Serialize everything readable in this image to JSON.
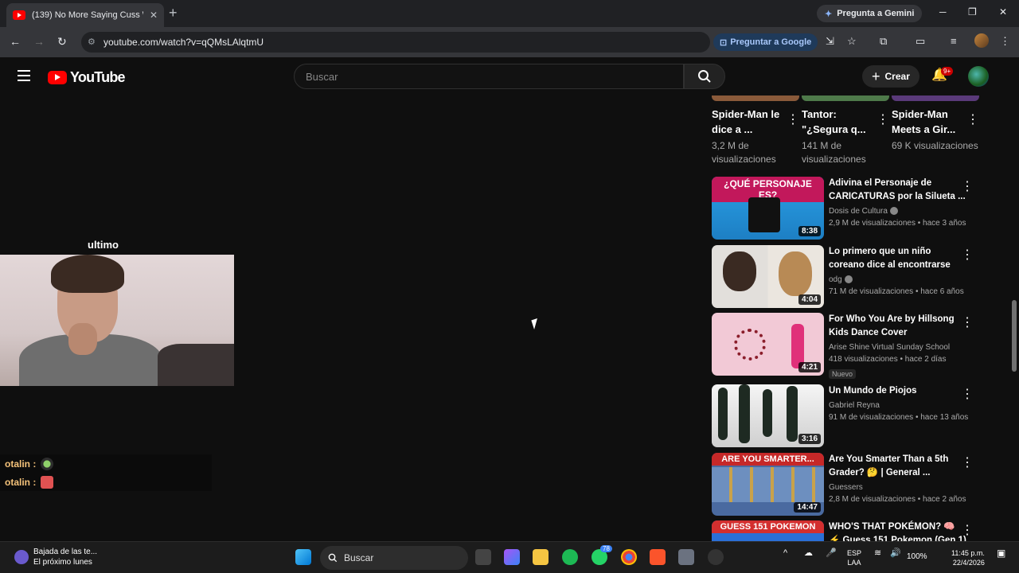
{
  "browser": {
    "tab_title": "(139) No More Saying Cuss Wo",
    "gemini_label": "Pregunta a Gemini",
    "url": "youtube.com/watch?v=qQMsLAlqtmU",
    "ask_google": "Preguntar a Google"
  },
  "youtube": {
    "logo_text": "YouTube",
    "search_placeholder": "Buscar",
    "create_label": "Crear",
    "notif_badge": "9+"
  },
  "overlay": {
    "label": "ultimo",
    "chat": [
      {
        "user": "otalin :",
        "emote": "green-face-emote"
      },
      {
        "user": "otalin :",
        "emote": "red-face-emote"
      }
    ]
  },
  "shorts": [
    {
      "title": "Spider-Man le dice a ...",
      "views": "3,2 M de visualizaciones",
      "thumb_color": "#8a5a3a"
    },
    {
      "title": "Tantor: \"¿Segura q...",
      "views": "141 M de visualizaciones",
      "thumb_color": "#4e7a4a"
    },
    {
      "title": "Spider-Man Meets a Gir...",
      "views": "69 K visualizaciones",
      "thumb_color": "#5a3a7a"
    }
  ],
  "videos": [
    {
      "title": "Adivina el Personaje de CARICATURAS por la Silueta ...",
      "channel": "Dosis de Cultura",
      "verified": true,
      "meta": "2,9 M de visualizaciones • hace 3 años",
      "duration": "8:38",
      "thumb_text": "¿QUÉ PERSONAJE ES?",
      "thumb_color": "#2aa0e6"
    },
    {
      "title": "Lo primero que un niño coreano dice al encontrarse con una ...",
      "channel": "odg",
      "verified": true,
      "meta": "71 M de visualizaciones • hace 6 años",
      "duration": "4:04",
      "thumb_text": "",
      "thumb_color": "#e8e4e0"
    },
    {
      "title": "For Who You Are by Hillsong Kids Dance Cover",
      "channel": "Arise Shine Virtual Sunday School",
      "verified": false,
      "meta": "418 visualizaciones • hace 2 días",
      "duration": "4:21",
      "badge": "Nuevo",
      "thumb_text": "",
      "thumb_color": "#f2c9d6"
    },
    {
      "title": "Un Mundo de Piojos",
      "channel": "Gabriel Reyna",
      "verified": false,
      "meta": "91 M de visualizaciones • hace 13 años",
      "duration": "3:16",
      "thumb_text": "",
      "thumb_color": "#d9d9d9"
    },
    {
      "title": "Are You Smarter Than a 5th Grader? 🤔 | General ...",
      "channel": "Guessers",
      "verified": false,
      "meta": "2,8 M de visualizaciones • hace 2 años",
      "duration": "14:47",
      "thumb_text": "ARE YOU SMARTER...",
      "thumb_color": "#4a6aa0"
    },
    {
      "title": "WHO'S THAT POKÉMON? 🧠 ⚡ Guess 151 Pokemon (Gen 1) ✅",
      "channel": "",
      "verified": false,
      "meta": "",
      "duration": "",
      "thumb_text": "GUESS 151 POKEMON",
      "thumb_color": "#2b6fd6"
    }
  ],
  "taskbar": {
    "weather_title": "Bajada de las te...",
    "weather_sub": "El próximo lunes",
    "search_label": "Buscar",
    "whatsapp_badge": "78",
    "lang": "ESP",
    "lang_sub": "LAA",
    "battery": "100%",
    "time": "11:45 p.m.",
    "date": "22/4/2026"
  }
}
